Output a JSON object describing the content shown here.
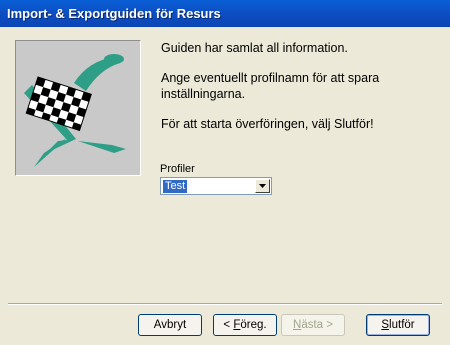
{
  "window": {
    "title": "Import- & Exportguiden för Resurs"
  },
  "messages": {
    "line1": "Guiden har samlat all information.",
    "line2": "Ange eventuellt profilnamn för att spara inställningarna.",
    "line3": "För att starta överföringen, välj Slutför!"
  },
  "profile": {
    "label": "Profiler",
    "selected": "Test"
  },
  "buttons": {
    "cancel": "Avbryt",
    "back_prefix": "< ",
    "back_mnemonic": "F",
    "back_rest": "öreg.",
    "next_mnemonic": "N",
    "next_rest": "ästa >",
    "finish_mnemonic": "S",
    "finish_rest": "lutför"
  },
  "colors": {
    "titlebar": "#0a5fd6",
    "flag_green": "#2e9f86",
    "selection": "#316ac5"
  },
  "icons": {
    "wizard_image": "checkered-flag-icon",
    "combo_arrow": "chevron-down-icon"
  }
}
